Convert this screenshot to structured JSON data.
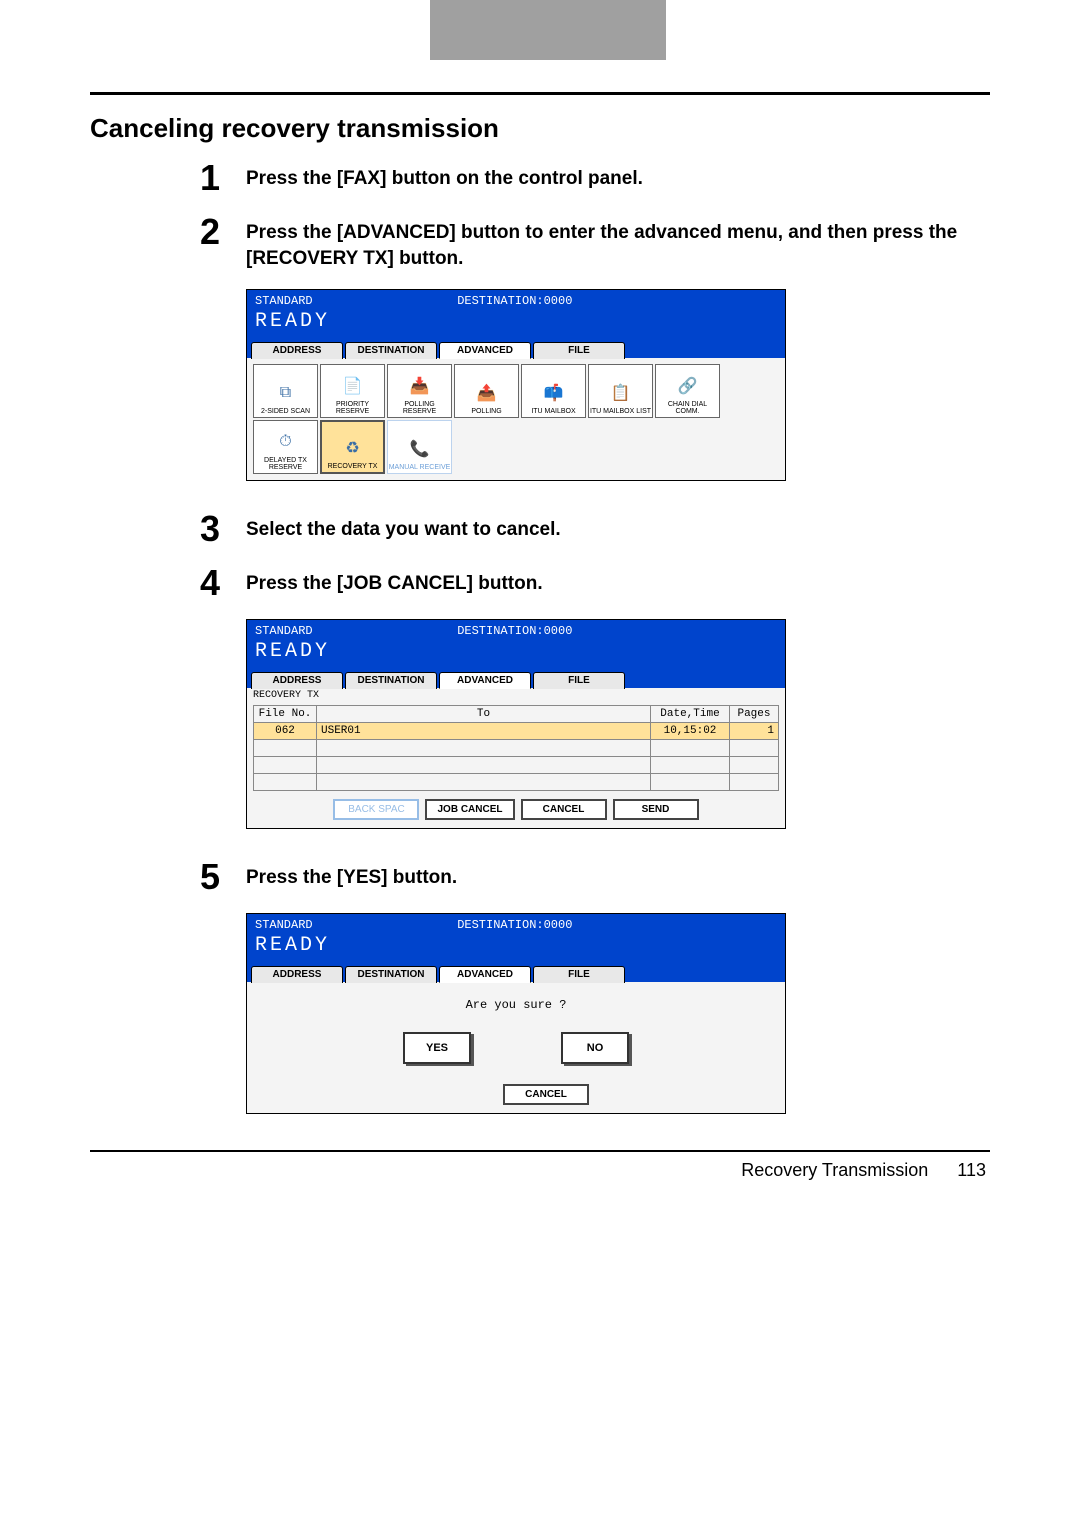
{
  "page": {
    "section_title": "Canceling recovery transmission",
    "footer_label": "Recovery Transmission",
    "footer_page": "113"
  },
  "steps": {
    "s1": {
      "num": "1",
      "text": "Press the [FAX] button on the control panel."
    },
    "s2": {
      "num": "2",
      "text": "Press the [ADVANCED] button to enter the advanced menu, and then press the [RECOVERY TX] button."
    },
    "s3": {
      "num": "3",
      "text": "Select the data you want to cancel."
    },
    "s4": {
      "num": "4",
      "text": "Press the [JOB CANCEL] button."
    },
    "s5": {
      "num": "5",
      "text": "Press the [YES] button."
    }
  },
  "common_header": {
    "mode": "STANDARD",
    "dest": "DESTINATION:0000",
    "ready": "READY",
    "tabs": {
      "address": "ADDRESS",
      "destination": "DESTINATION",
      "advanced": "ADVANCED",
      "file": "FILE"
    }
  },
  "screen_advanced": {
    "icons": {
      "two_sided": "2-SIDED SCAN",
      "priority": "PRIORITY RESERVE",
      "polling_reserve": "POLLING RESERVE",
      "polling": "POLLING",
      "itu_mailbox": "ITU MAILBOX",
      "itu_mailbox_list": "ITU MAILBOX LIST",
      "chain": "CHAIN DIAL COMM.",
      "delayed": "DELAYED TX RESERVE",
      "recovery": "RECOVERY TX",
      "manual_recv": "MANUAL RECEIVE"
    }
  },
  "screen_joblist": {
    "sublabel": "RECOVERY TX",
    "headers": {
      "fileno": "File No.",
      "to": "To",
      "datetime": "Date,Time",
      "pages": "Pages"
    },
    "row": {
      "fileno": "062",
      "to": "USER01",
      "datetime": "10,15:02",
      "pages": "1"
    },
    "buttons": {
      "backspace": "BACK SPAC",
      "jobcancel": "JOB CANCEL",
      "cancel": "CANCEL",
      "send": "SEND"
    }
  },
  "screen_confirm": {
    "question": "Are you sure ?",
    "yes": "YES",
    "no": "NO",
    "cancel": "CANCEL"
  }
}
